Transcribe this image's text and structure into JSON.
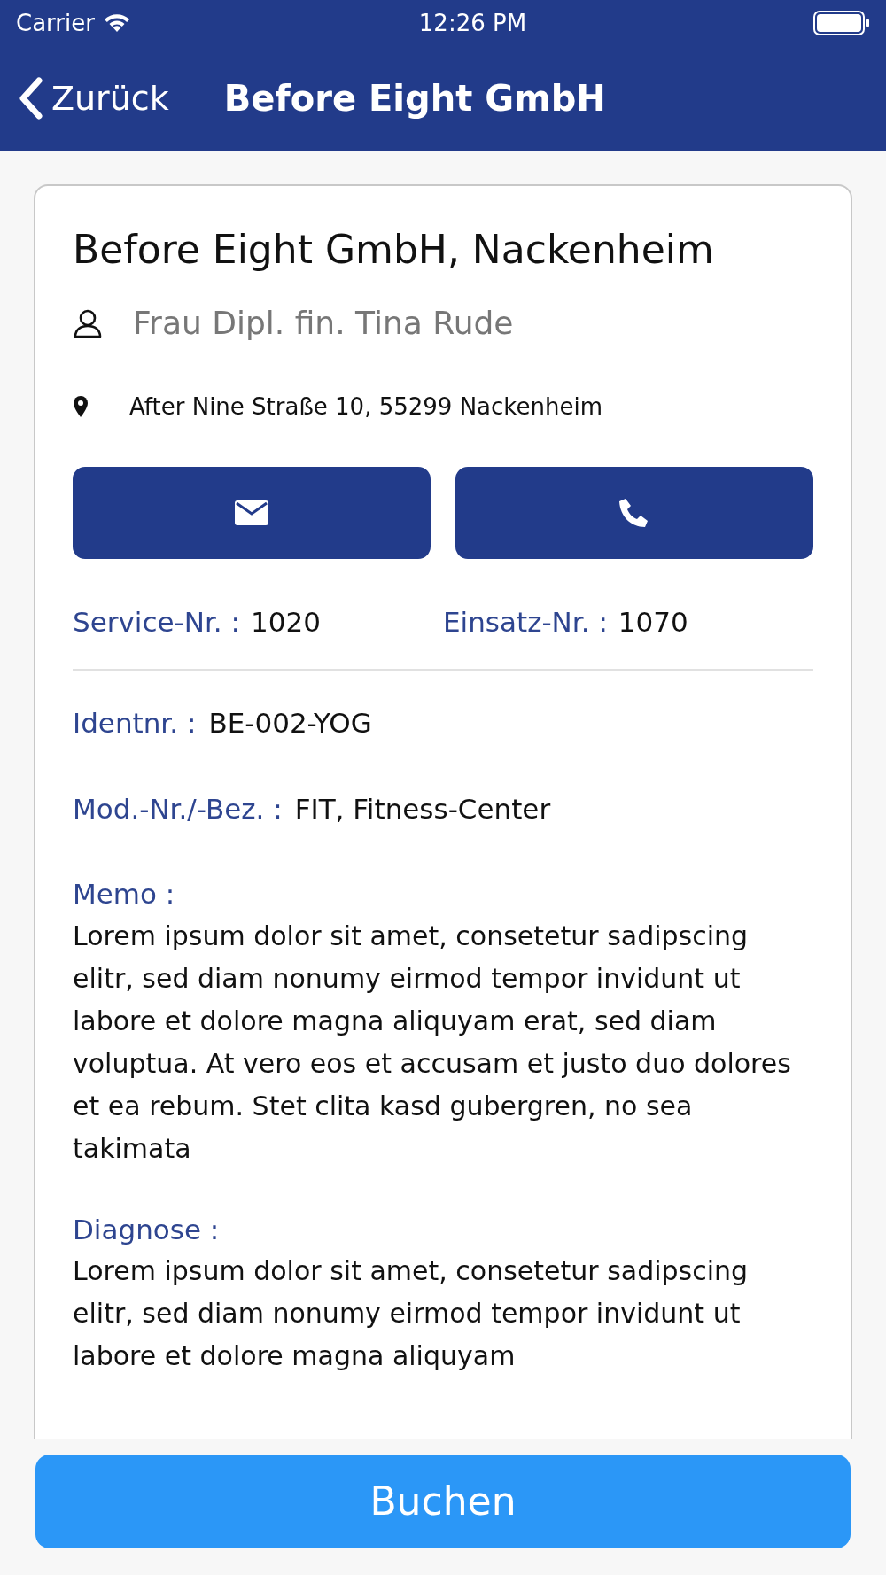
{
  "status_bar": {
    "carrier": "Carrier",
    "time": "12:26 PM"
  },
  "nav_bar": {
    "back_label": "Zurück",
    "title": "Before Eight GmbH"
  },
  "customer": {
    "name": "Before Eight GmbH, Nackenheim",
    "contact": "Frau Dipl. fin. Tina Rude",
    "address": "After Nine Straße 10, 55299 Nackenheim"
  },
  "numbers": [
    {
      "label": "Service-Nr. :",
      "value": "1020"
    },
    {
      "label": "Einsatz-Nr. :",
      "value": "1070"
    }
  ],
  "details": [
    {
      "kind": "inline",
      "label": "Identnr. :",
      "value": "BE-002-YOG"
    },
    {
      "kind": "inline",
      "label": "Mod.-Nr./-Bez. :",
      "value": "FIT, Fitness-Center"
    },
    {
      "kind": "block",
      "label": "Memo :",
      "value": "Lorem ipsum dolor sit amet, consetetur sadipscing elitr, sed diam nonumy eirmod tempor invidunt ut labore et dolore magna aliquyam erat, sed diam voluptua. At vero eos et accusam et justo duo dolores et ea rebum. Stet clita kasd gubergren, no sea takimata"
    },
    {
      "kind": "block",
      "label": "Diagnose :",
      "value": "Lorem ipsum dolor sit amet, consetetur sadipscing elitr, sed diam nonumy eirmod tempor invidunt ut labore et dolore magna aliquyam"
    }
  ],
  "book_button": "Buchen"
}
